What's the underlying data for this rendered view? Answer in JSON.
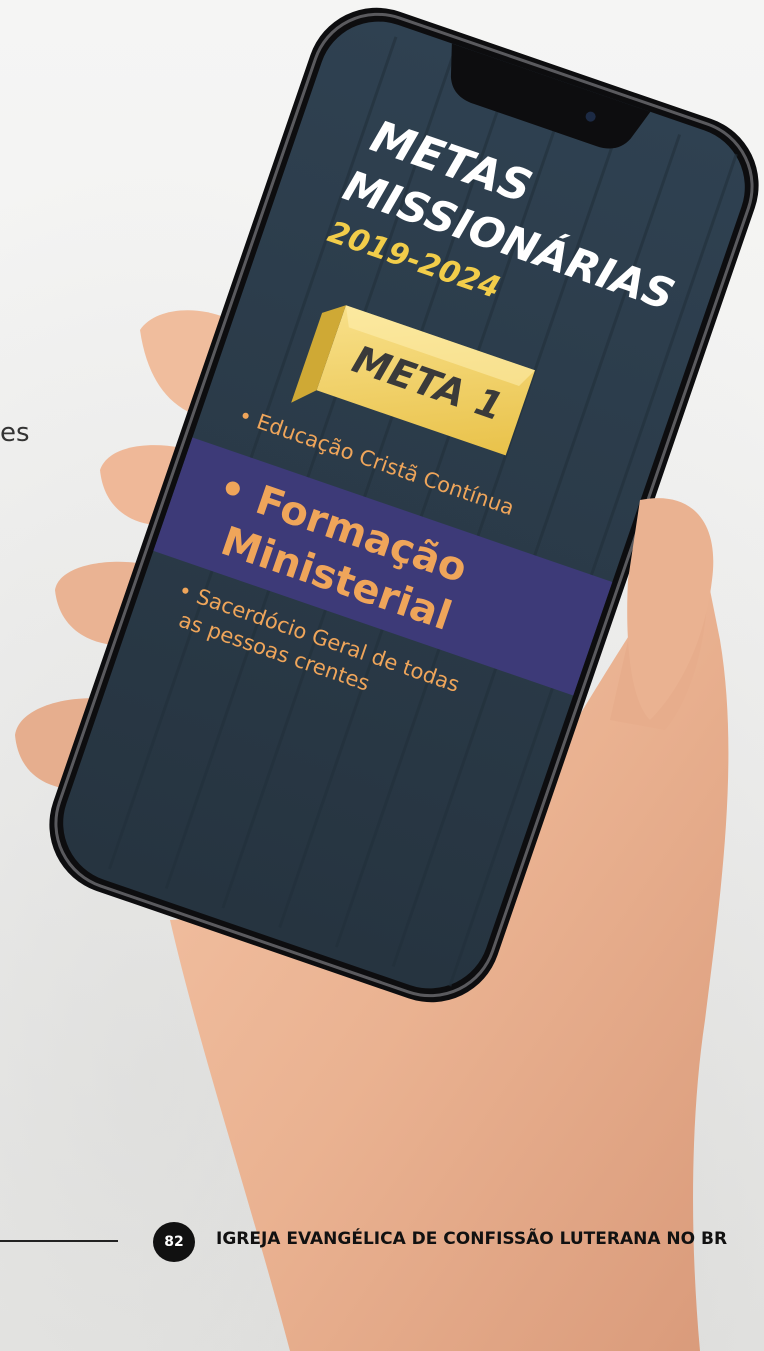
{
  "page": {
    "side_fragment": "es",
    "page_number": "82",
    "footer_title": "IGREJA EVANGÉLICA DE CONFISSÃO LUTERANA NO BR"
  },
  "phone_screen": {
    "title_line1": "METAS",
    "title_line2": "MISSIONÁRIAS",
    "years": "2019-2024",
    "banner": "META 1",
    "item1": "• Educação Cristã Contínua",
    "item2_line1": "• Formação",
    "item2_line2": "Ministerial",
    "item3_line1": "• Sacerdócio Geral de todas",
    "item3_line2": "as pessoas crentes"
  },
  "colors": {
    "screen_bg": "#2a3a48",
    "title": "#ffffff",
    "accent_yellow": "#f2cd4a",
    "orange_text": "#efa55a",
    "highlight_band": "#3d3a78"
  }
}
